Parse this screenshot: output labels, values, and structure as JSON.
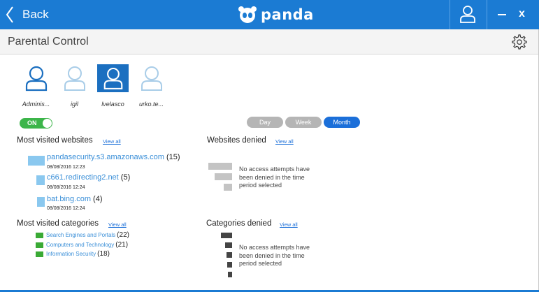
{
  "titlebar": {
    "back_label": "Back",
    "brand": "panda",
    "close_label": "x"
  },
  "header": {
    "title": "Parental Control"
  },
  "users": [
    {
      "name": "Adminis...",
      "selected": false
    },
    {
      "name": "igil",
      "selected": false
    },
    {
      "name": "lvelasco",
      "selected": true
    },
    {
      "name": "urko.te...",
      "selected": false
    }
  ],
  "toggle": {
    "label": "ON"
  },
  "periods": [
    "Day",
    "Week",
    "Month"
  ],
  "active_period": "Month",
  "view_all": "View all",
  "most_visited_websites": {
    "title": "Most visited websites",
    "items": [
      {
        "url": "pandasecurity.s3.amazonaws.com",
        "count": "(15)",
        "date": "08/08/2016 12:23"
      },
      {
        "url": "c661.redirecting2.net",
        "count": "(5)",
        "date": "08/08/2016 12:24"
      },
      {
        "url": "bat.bing.com",
        "count": "(4)",
        "date": "08/08/2016 12:24"
      }
    ]
  },
  "websites_denied": {
    "title": "Websites denied",
    "note": "No access attempts have been denied in the time period selected"
  },
  "most_visited_categories": {
    "title": "Most visited categories",
    "items": [
      {
        "label": "Search Engines and Portals",
        "count": "(22)"
      },
      {
        "label": "Computers and Technology",
        "count": "(21)"
      },
      {
        "label": "Information Security",
        "count": "(18)"
      }
    ]
  },
  "categories_denied": {
    "title": "Categories denied",
    "note": "No access attempts have been denied in the time period selected"
  },
  "colors": {
    "brand_blue": "#1b7bd3",
    "active_period": "#1b6fd9",
    "on_green": "#3cb54a",
    "category_green": "#3aaa35",
    "site_bar": "#8ac8ef",
    "link": "#3a8fd8"
  }
}
